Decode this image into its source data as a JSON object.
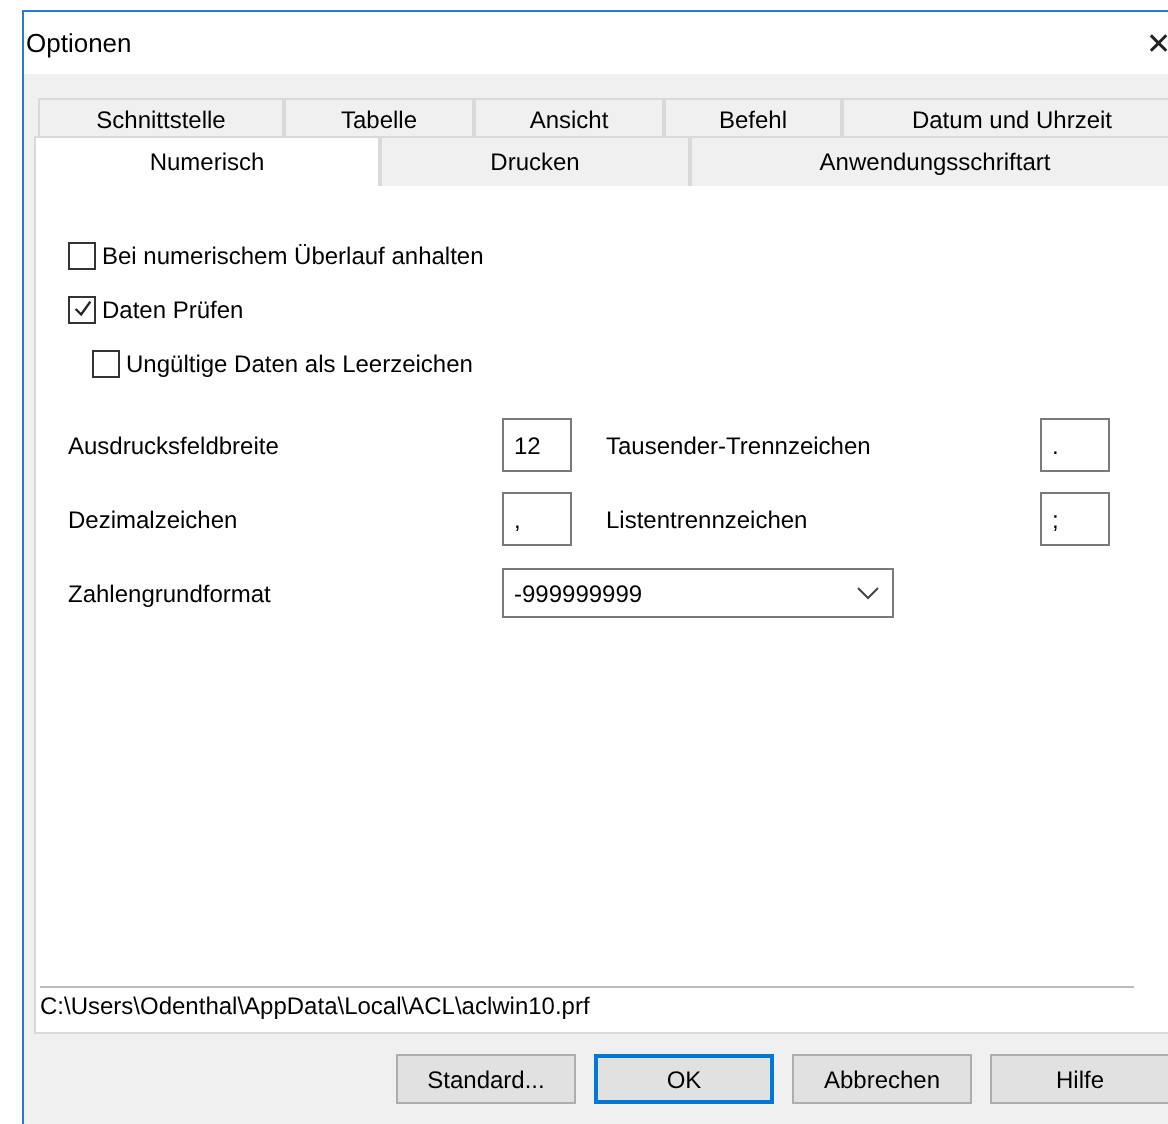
{
  "window": {
    "title": "Optionen",
    "close": "✕"
  },
  "tab_rows": [
    [
      {
        "label": "Schnittstelle",
        "selected": false
      },
      {
        "label": "Tabelle",
        "selected": false
      },
      {
        "label": "Ansicht",
        "selected": false
      },
      {
        "label": "Befehl",
        "selected": false
      },
      {
        "label": "Datum und Uhrzeit",
        "selected": false
      }
    ],
    [
      {
        "label": "Numerisch",
        "selected": true
      },
      {
        "label": "Drucken",
        "selected": false
      },
      {
        "label": "Anwendungsschriftart",
        "selected": false
      }
    ]
  ],
  "checkboxes": [
    {
      "label": "Bei numerischem Überlauf anhalten",
      "checked": false
    },
    {
      "label": "Daten Prüfen",
      "checked": true,
      "children": [
        {
          "label": "Ungültige Daten als Leerzeichen",
          "checked": false
        }
      ]
    }
  ],
  "field_rows": [
    [
      {
        "label": "Ausdrucksfeldbreite",
        "value": "12"
      },
      {
        "label": "Tausender-Trennzeichen",
        "value": "."
      }
    ],
    [
      {
        "label": "Dezimalzeichen",
        "value": ","
      },
      {
        "label": "Listentrennzeichen",
        "value": ";"
      }
    ]
  ],
  "combo": {
    "label": "Zahlengrundformat",
    "value": "-999999999"
  },
  "path": "C:\\Users\\Odenthal\\AppData\\Local\\ACL\\aclwin10.prf",
  "buttons": [
    {
      "label": "Standard...",
      "default": false
    },
    {
      "label": "OK",
      "default": true
    },
    {
      "label": "Abbrechen",
      "default": false
    },
    {
      "label": "Hilfe",
      "default": false
    }
  ]
}
